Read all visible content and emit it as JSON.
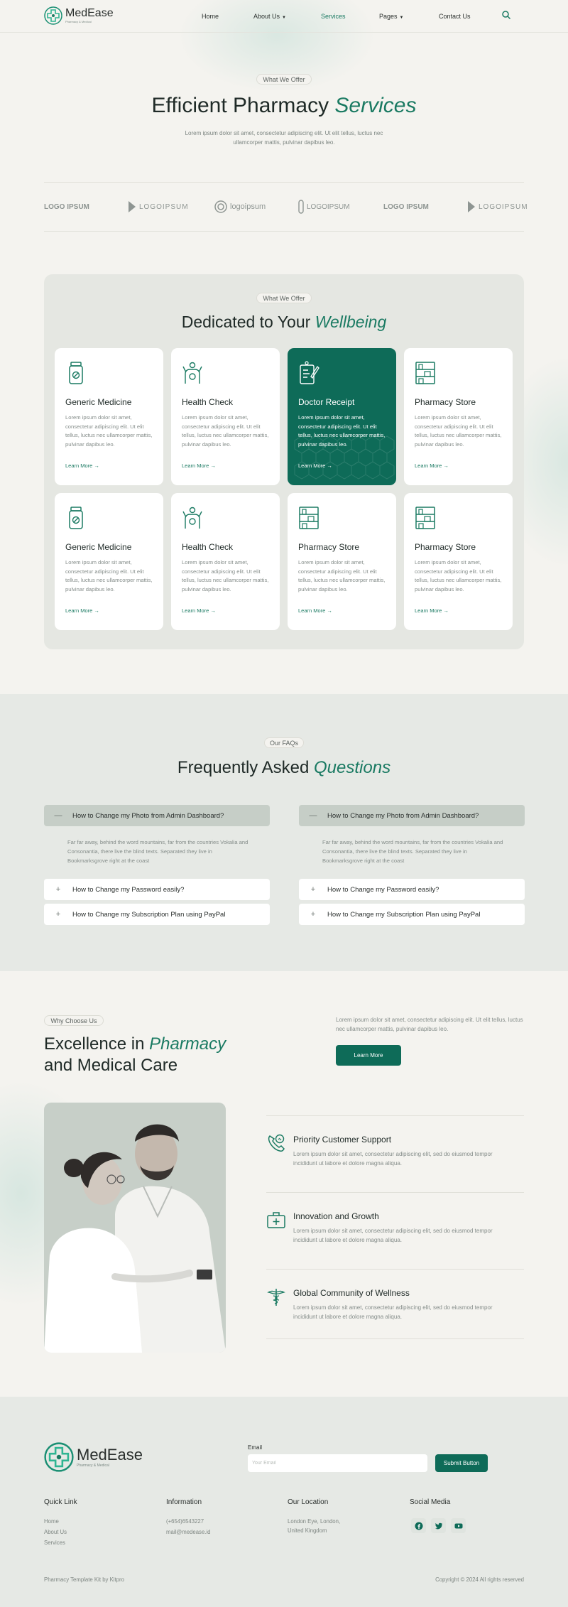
{
  "brand": {
    "name": "MedEase",
    "tagline": "Pharmacy & Medical",
    "accent_color": "#1a7a62",
    "dark_green": "#0e6b58"
  },
  "nav": {
    "items": [
      {
        "label": "Home"
      },
      {
        "label": "About Us"
      },
      {
        "label": "Services"
      },
      {
        "label": "Pages"
      },
      {
        "label": "Contact Us"
      }
    ],
    "active": "Services",
    "search_icon": "search-icon"
  },
  "hero": {
    "pill": "What We Offer",
    "title_plain": "Efficient Pharmacy",
    "title_accent": "Services",
    "desc": "Lorem ipsum dolor sit amet, consectetur adipiscing elit. Ut elit tellus, luctus nec ullamcorper mattis, pulvinar dapibus leo."
  },
  "partner_logos": [
    {
      "text": "LOGO IPSUM"
    },
    {
      "text": "LOGOIPSUM"
    },
    {
      "text": "logoipsum"
    },
    {
      "text": "LOGOIPSUM"
    },
    {
      "text": "LOGO IPSUM"
    },
    {
      "text": "LOGOIPSUM"
    }
  ],
  "services": {
    "pill": "What We Offer",
    "title_plain": "Dedicated to Your",
    "title_accent": "Wellbeing",
    "cards": [
      {
        "title": "Generic Medicine",
        "desc": "Lorem ipsum dolor sit amet, consectetur adipiscing elit. Ut elit tellus, luctus nec ullamcorper mattis, pulvinar dapibus leo.",
        "link": "Learn More →",
        "icon": "medicine-bottle-icon",
        "active": false
      },
      {
        "title": "Health Check",
        "desc": "Lorem ipsum dolor sit amet, consectetur adipiscing elit. Ut elit tellus, luctus nec ullamcorper mattis, pulvinar dapibus leo.",
        "link": "Learn More →",
        "icon": "health-check-icon",
        "active": false
      },
      {
        "title": "Doctor Receipt",
        "desc": "Lorem ipsum dolor sit amet, consectetur adipiscing elit. Ut elit tellus, luctus nec ullamcorper mattis, pulvinar dapibus leo.",
        "link": "Learn More →",
        "icon": "prescription-icon",
        "active": true
      },
      {
        "title": "Pharmacy Store",
        "desc": "Lorem ipsum dolor sit amet, consectetur adipiscing elit. Ut elit tellus, luctus nec ullamcorper mattis, pulvinar dapibus leo.",
        "link": "Learn More →",
        "icon": "store-shelf-icon",
        "active": false
      },
      {
        "title": "Generic Medicine",
        "desc": "Lorem ipsum dolor sit amet, consectetur adipiscing elit. Ut elit tellus, luctus nec ullamcorper mattis, pulvinar dapibus leo.",
        "link": "Learn More →",
        "icon": "medicine-bottle-icon",
        "active": false
      },
      {
        "title": "Health Check",
        "desc": "Lorem ipsum dolor sit amet, consectetur adipiscing elit. Ut elit tellus, luctus nec ullamcorper mattis, pulvinar dapibus leo.",
        "link": "Learn More →",
        "icon": "health-check-icon",
        "active": false
      },
      {
        "title": "Pharmacy Store",
        "desc": "Lorem ipsum dolor sit amet, consectetur adipiscing elit. Ut elit tellus, luctus nec ullamcorper mattis, pulvinar dapibus leo.",
        "link": "Learn More →",
        "icon": "store-shelf-icon",
        "active": false
      },
      {
        "title": "Pharmacy Store",
        "desc": "Lorem ipsum dolor sit amet, consectetur adipiscing elit. Ut elit tellus, luctus nec ullamcorper mattis, pulvinar dapibus leo.",
        "link": "Learn More →",
        "icon": "store-shelf-icon",
        "active": false
      }
    ]
  },
  "faq": {
    "pill": "Our FAQs",
    "title_plain": "Frequently Asked",
    "title_accent": "Questions",
    "columns": [
      {
        "open_question": "How to Change my Photo from Admin Dashboard?",
        "open_answer": "Far far away, behind the word mountains, far from the countries Vokalia and Consonantia, there live the blind texts. Separated they live in Bookmarksgrove right at the coast",
        "closed": [
          "How to Change my Password easily?",
          "How to Change my Subscription Plan using PayPal"
        ]
      },
      {
        "open_question": "How to Change my Photo from Admin Dashboard?",
        "open_answer": "Far far away, behind the word mountains, far from the countries Vokalia and Consonantia, there live the blind texts. Separated they live in Bookmarksgrove right at the coast",
        "closed": [
          "How to Change my Password easily?",
          "How to Change my Subscription Plan using PayPal"
        ]
      }
    ],
    "open_sign": "—",
    "closed_sign": "+"
  },
  "why": {
    "pill": "Why Choose Us",
    "title_line1_plain": "Excellence in",
    "title_line1_accent": "Pharmacy",
    "title_line2": "and Medical Care",
    "desc": "Lorem ipsum dolor sit amet, consectetur adipiscing elit. Ut elit tellus, luctus nec ullamcorper mattis, pulvinar dapibus leo.",
    "button": "Learn More",
    "features": [
      {
        "title": "Priority Customer Support",
        "desc": "Lorem ipsum dolor sit amet, consectetur adipiscing elit, sed do eiusmod tempor incididunt ut labore et dolore magna aliqua.",
        "icon": "phone-support-icon"
      },
      {
        "title": "Innovation and Growth",
        "desc": "Lorem ipsum dolor sit amet, consectetur adipiscing elit, sed do eiusmod tempor incididunt ut labore et dolore magna aliqua.",
        "icon": "medical-kit-icon"
      },
      {
        "title": "Global Community of Wellness",
        "desc": "Lorem ipsum dolor sit amet, consectetur adipiscing elit, sed do eiusmod tempor incididunt ut labore et dolore magna aliqua.",
        "icon": "caduceus-icon"
      }
    ]
  },
  "footer": {
    "email_label": "Email",
    "email_placeholder": "Your Email",
    "submit": "Submit Button",
    "quick_link": {
      "heading": "Quick Link",
      "items": [
        "Home",
        "About Us",
        "Services"
      ]
    },
    "information": {
      "heading": "Information",
      "items": [
        "(+654)6543227",
        "mail@medease.id"
      ]
    },
    "location": {
      "heading": "Our Location",
      "items": [
        "London Eye, London,",
        "United Kingdom"
      ]
    },
    "social": {
      "heading": "Social Media",
      "icons": [
        "facebook-icon",
        "twitter-icon",
        "youtube-icon"
      ]
    },
    "credit": "Pharmacy Template Kit by Kitpro",
    "copyright": "Copyright © 2024 All rights reserved"
  }
}
